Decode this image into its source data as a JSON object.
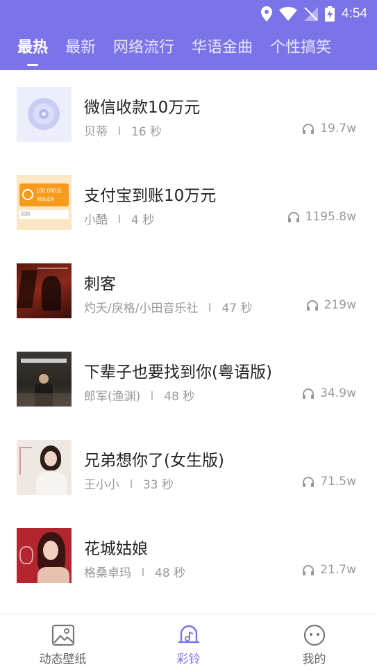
{
  "status": {
    "time": "4:54"
  },
  "tabs": [
    {
      "label": "最热",
      "active": true
    },
    {
      "label": "最新"
    },
    {
      "label": "网络流行"
    },
    {
      "label": "华语金曲"
    },
    {
      "label": "个性搞笑"
    }
  ],
  "songs": [
    {
      "title": "微信收款10万元",
      "artist": "贝蒂",
      "duration": "16 秒",
      "plays": "19.7w"
    },
    {
      "title": "支付宝到账10万元",
      "artist": "小酷",
      "duration": "4 秒",
      "plays": "1195.8w"
    },
    {
      "title": "刺客",
      "artist": "灼夭/戾格/小田音乐社",
      "duration": "47 秒",
      "plays": "219w"
    },
    {
      "title": "下辈子也要找到你(粤语版)",
      "artist": "郎军(渔渊)",
      "duration": "48 秒",
      "plays": "34.9w"
    },
    {
      "title": "兄弟想你了(女生版)",
      "artist": "王小小",
      "duration": "33 秒",
      "plays": "71.5w"
    },
    {
      "title": "花城姑娘",
      "artist": "格桑卓玛",
      "duration": "48 秒",
      "plays": "21.7w"
    }
  ],
  "covers": {
    "alipay_amount": "100,000元",
    "alipay_text": "转账成功",
    "alipay_receipt": "回执"
  },
  "nav": [
    {
      "label": "动态壁纸",
      "icon": "wallpaper-icon"
    },
    {
      "label": "彩铃",
      "icon": "ringtone-icon",
      "active": true
    },
    {
      "label": "我的",
      "icon": "profile-icon"
    }
  ],
  "colors": {
    "accent": "#7b74e8"
  }
}
